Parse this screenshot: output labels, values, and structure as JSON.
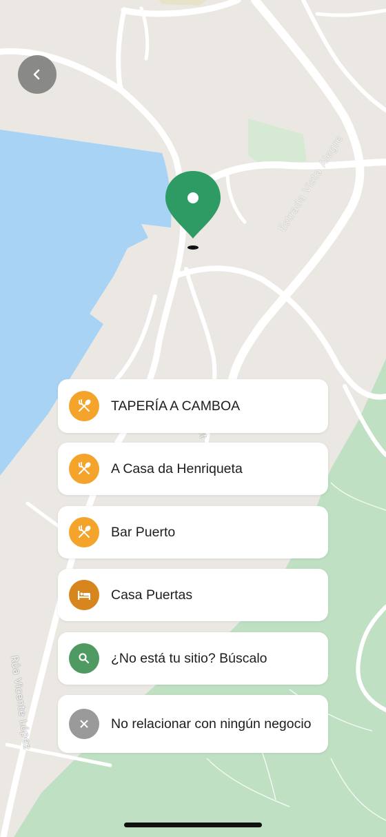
{
  "map": {
    "road_labels": {
      "estrada_vista_alegre": "Estrada Vista Alegre",
      "rua_vicente_lopez": "Rúa Vicente López",
      "partial_label": "st"
    },
    "colors": {
      "land": "#ebe8e4",
      "water": "#a9d3f4",
      "forest": "#bfe0c3",
      "road": "#ffffff",
      "pin": "#2e9b65"
    },
    "pin_icon": "map-pin-icon"
  },
  "back_button": {
    "icon": "chevron-left-icon"
  },
  "business_options": [
    {
      "label": "TAPERÍA A CAMBOA",
      "icon": "restaurant-icon",
      "color": "#f4a42b"
    },
    {
      "label": "A Casa da Henriqueta",
      "icon": "restaurant-icon",
      "color": "#f4a42b"
    },
    {
      "label": "Bar Puerto",
      "icon": "restaurant-icon",
      "color": "#f4a42b"
    },
    {
      "label": "Casa Puertas",
      "icon": "bed-icon",
      "color": "#d7861e"
    },
    {
      "label": "¿No está tu sitio? Búscalo",
      "icon": "search-icon",
      "color": "#4f9a62"
    },
    {
      "label": "No relacionar con ningún negocio",
      "icon": "close-icon",
      "color": "#9a9a9a"
    }
  ]
}
